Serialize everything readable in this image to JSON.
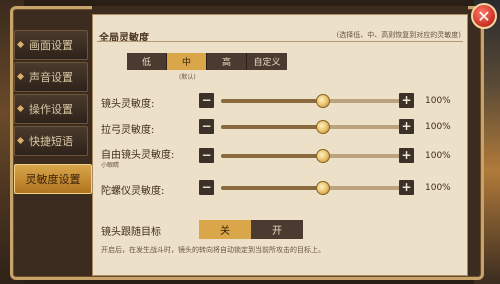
{
  "sidebar": {
    "items": [
      {
        "label": "画面设置",
        "active": false
      },
      {
        "label": "声音设置",
        "active": false
      },
      {
        "label": "操作设置",
        "active": false
      },
      {
        "label": "快捷短语",
        "active": false
      },
      {
        "label": "灵敏度设置",
        "active": true
      }
    ]
  },
  "section": {
    "title": "全局灵敏度",
    "hint": "(选择低、中、高则恢复到对应的灵敏度)"
  },
  "modes": {
    "options": [
      "低",
      "中",
      "高",
      "自定义"
    ],
    "selected": "中",
    "default_note": "(默认)"
  },
  "sliders": [
    {
      "label": "镜头灵敏度:",
      "sub": "",
      "value": 100,
      "percent_text": "100%",
      "position": 0.55
    },
    {
      "label": "拉弓灵敏度:",
      "sub": "",
      "value": 100,
      "percent_text": "100%",
      "position": 0.55
    },
    {
      "label": "自由镜头灵敏度:",
      "sub": "小眼睛",
      "value": 100,
      "percent_text": "100%",
      "position": 0.55
    },
    {
      "label": "陀螺仪灵敏度:",
      "sub": "",
      "value": 100,
      "percent_text": "100%",
      "position": 0.55
    }
  ],
  "follow": {
    "label": "镜头跟随目标",
    "options": [
      "关",
      "开"
    ],
    "selected": "关",
    "footnote": "开启后，在发生战斗时，镜头的转向将自动锁定到当前所攻击的目标上。"
  },
  "icons": {
    "close": "close-icon",
    "minus": "minus-icon",
    "plus": "plus-icon"
  },
  "colors": {
    "accent": "#d9a64a",
    "panel": "#ece0c8",
    "close": "#d2392a"
  }
}
